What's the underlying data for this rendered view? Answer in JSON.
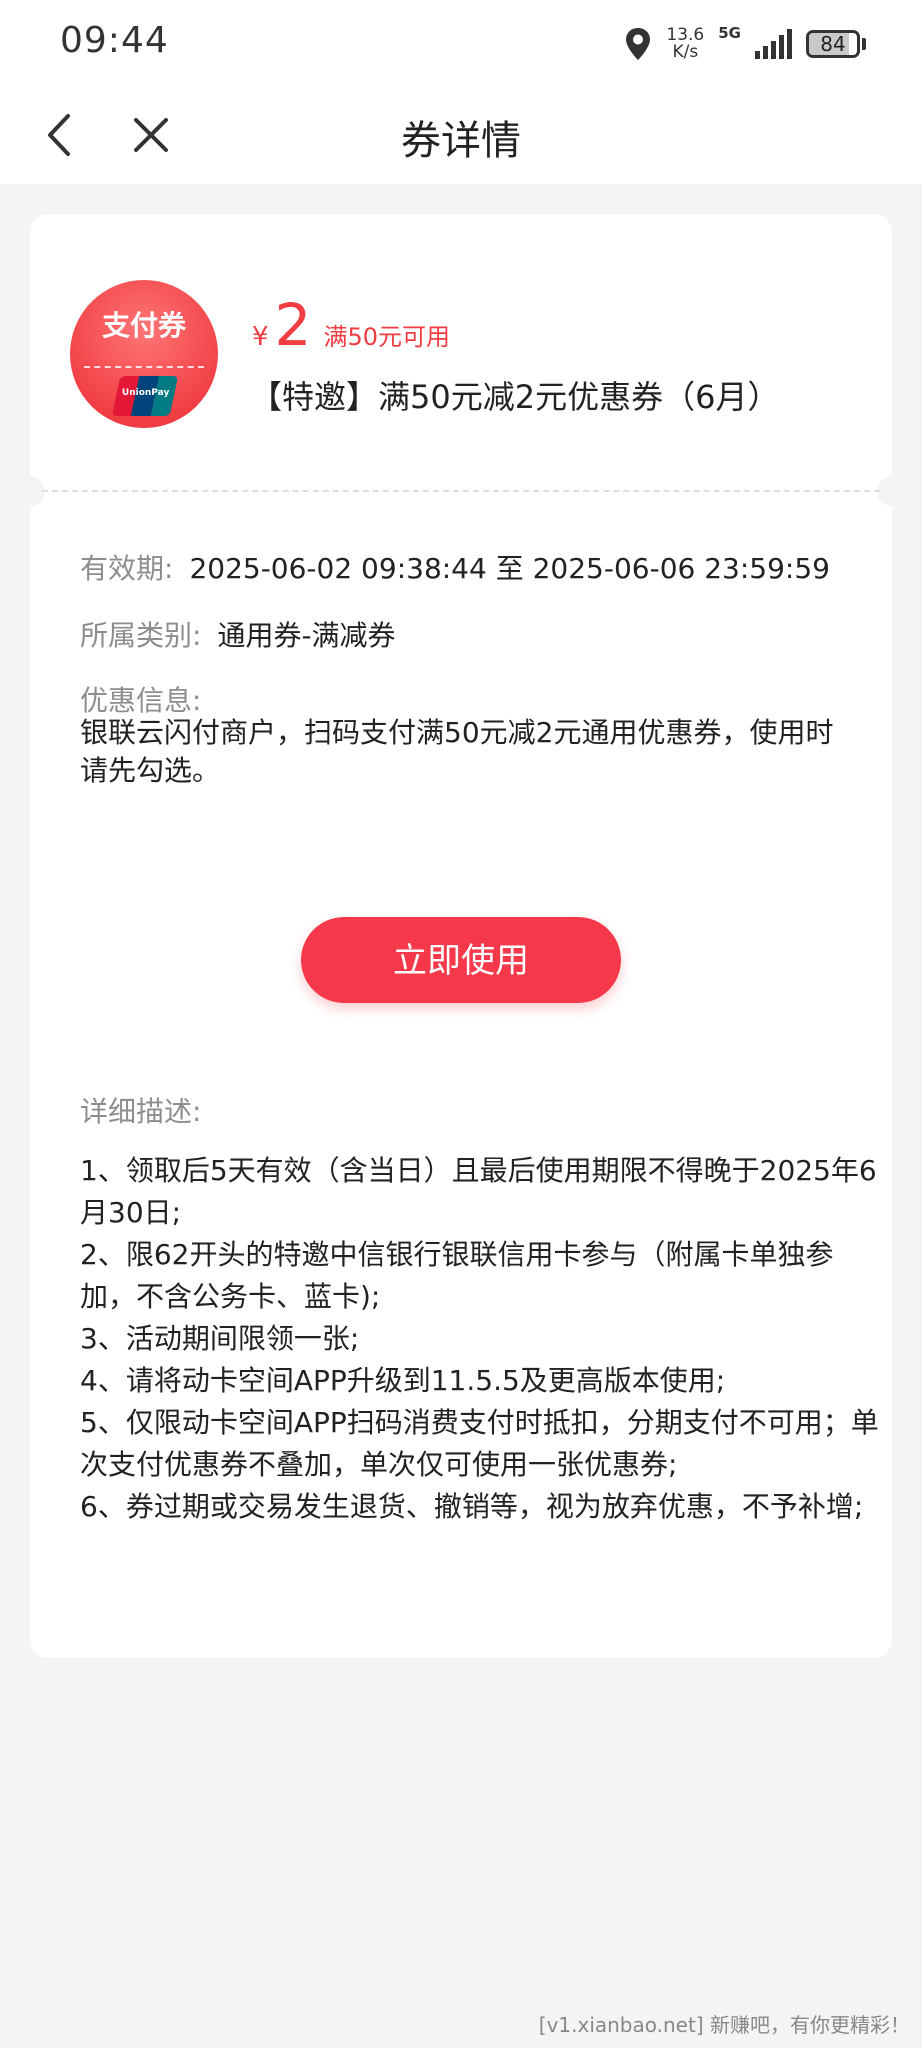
{
  "status_bar": {
    "time": "09:44",
    "net_speed_value": "13.6",
    "net_speed_unit": "K/s",
    "network": "5G",
    "battery": "84",
    "battery_level": 0.84
  },
  "nav": {
    "title": "券详情",
    "back_icon": "chevron-left-icon",
    "close_icon": "close-icon"
  },
  "coupon": {
    "badge_label": "支付券",
    "currency": "¥",
    "amount": "2",
    "threshold": "满50元可用",
    "name": "【特邀】满50元减2元优惠券（6月）",
    "accent_color": "#f03d42"
  },
  "info": {
    "validity_label": "有效期:",
    "validity_value": "2025-06-02 09:38:44 至 2025-06-06 23:59:59",
    "category_label": "所属类别:",
    "category_value": "通用券-满减券",
    "benefit_label": "优惠信息:",
    "benefit_text": "银联云闪付商户，扫码支付满50元减2元通用优惠券，使用时请先勾选。"
  },
  "action": {
    "use_label": "立即使用"
  },
  "details": {
    "label": "详细描述:",
    "items": [
      "1、领取后5天有效（含当日）且最后使用期限不得晚于2025年6月30日;",
      "2、限62开头的特邀中信银行银联信用卡参与（附属卡单独参加，不含公务卡、蓝卡);",
      "3、活动期间限领一张;",
      "4、请将动卡空间APP升级到11.5.5及更高版本使用;",
      "5、仅限动卡空间APP扫码消费支付时抵扣，分期支付不可用；单次支付优惠券不叠加，单次仅可使用一张优惠券;",
      "6、券过期或交易发生退货、撤销等，视为放弃优惠，不予补增;"
    ]
  },
  "watermark": "[v1.xianbao.net] 新赚吧，有你更精彩！"
}
